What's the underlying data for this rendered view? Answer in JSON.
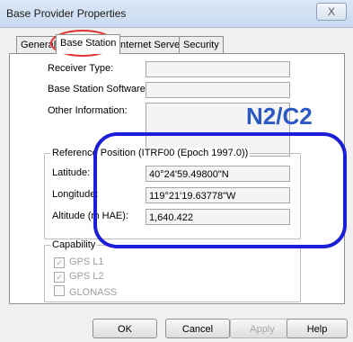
{
  "window": {
    "title": "Base Provider Properties",
    "close_glyph": "X"
  },
  "tabs": [
    {
      "label": "General"
    },
    {
      "label": "Base Station"
    },
    {
      "label": "Internet Server"
    },
    {
      "label": "Security"
    }
  ],
  "fields": {
    "receiver_type": {
      "label": "Receiver Type:",
      "value": ""
    },
    "base_station_software": {
      "label": "Base Station Software:",
      "value": ""
    },
    "other_information": {
      "label": "Other Information:",
      "value": ""
    }
  },
  "reference_position": {
    "legend": "Reference Position (ITRF00 (Epoch 1997.0))",
    "latitude": {
      "label": "Latitude:",
      "value": "40°24'59.49800\"N"
    },
    "longitude": {
      "label": "Longitude:",
      "value": "119°21'19.63778\"W"
    },
    "altitude": {
      "label": "Altitude (m HAE):",
      "value": "1,640.422"
    }
  },
  "capability": {
    "legend": "Capability",
    "items": [
      {
        "label": "GPS L1",
        "checked": true
      },
      {
        "label": "GPS L2",
        "checked": true
      },
      {
        "label": "GLONASS",
        "checked": false
      }
    ]
  },
  "buttons": {
    "ok": "OK",
    "cancel": "Cancel",
    "apply": "Apply",
    "help": "Help"
  },
  "annotations": {
    "overlay_text": "N2/C2",
    "ellipse_color": "#e03030",
    "box_color": "#1c1fd8"
  }
}
